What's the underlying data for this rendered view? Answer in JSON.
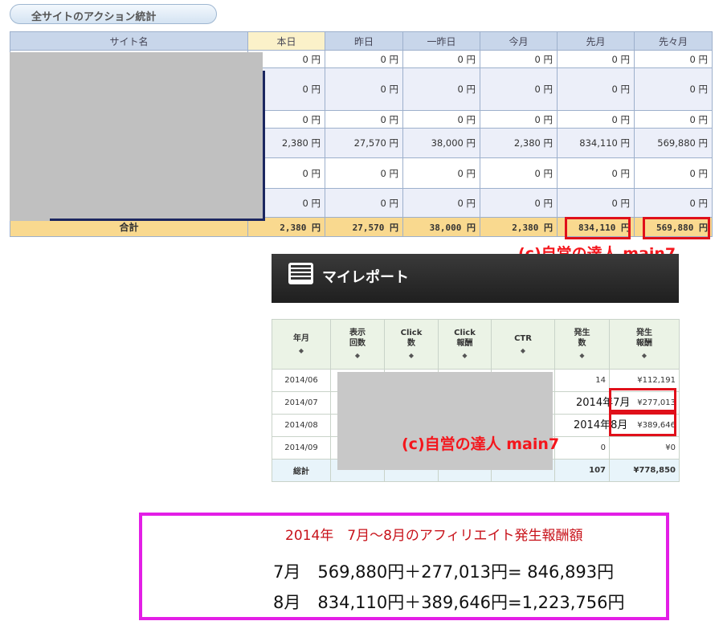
{
  "stats": {
    "title": "全サイトのアクション統計",
    "headers": [
      "サイト名",
      "本日",
      "昨日",
      "一昨日",
      "今月",
      "先月",
      "先々月"
    ],
    "rows": [
      [
        "0 円",
        "0 円",
        "0 円",
        "0 円",
        "0 円",
        "0 円"
      ],
      [
        "0 円",
        "0 円",
        "0 円",
        "0 円",
        "0 円",
        "0 円"
      ],
      [
        "0 円",
        "0 円",
        "0 円",
        "0 円",
        "0 円",
        "0 円"
      ],
      [
        "2,380 円",
        "27,570 円",
        "38,000 円",
        "2,380 円",
        "834,110 円",
        "569,880 円"
      ],
      [
        "0 円",
        "0 円",
        "0 円",
        "0 円",
        "0 円",
        "0 円"
      ],
      [
        "0 円",
        "0 円",
        "0 円",
        "0 円",
        "0 円",
        "0 円"
      ]
    ],
    "total_label": "合計",
    "totals": [
      "2,380 円",
      "27,570 円",
      "38,000 円",
      "2,380 円",
      "834,110 円",
      "569,880 円"
    ]
  },
  "watermark": "(c)自営の達人 main7",
  "my_report": {
    "title": "マイレポート",
    "headers": [
      "年月",
      "表示\n回数",
      "Click\n数",
      "Click\n報酬",
      "CTR",
      "発生\n数",
      "発生\n報酬"
    ],
    "sort_glyph": "◆",
    "rows": [
      {
        "ym": "2014/06",
        "count": "14",
        "reward": "¥112,191"
      },
      {
        "ym": "2014/07",
        "count": "",
        "reward": "¥277,013"
      },
      {
        "ym": "2014/08",
        "count": "",
        "reward": "¥389,646"
      },
      {
        "ym": "2014/09",
        "count": "0",
        "reward": "¥0"
      }
    ],
    "total_label": "総計",
    "total_count": "107",
    "total_reward": "¥778,850",
    "overlay_jul": "2014年7月",
    "overlay_aug": "2014年8月"
  },
  "summary": {
    "heading": "2014年　7月～8月のアフィリエイト発生報酬額",
    "line1": "7月　569,880円＋277,013円=  846,893円",
    "line2": "8月　834,110円＋389,646円=1,223,756円"
  },
  "colors": {
    "highlight_red": "#e0101a",
    "summary_border": "#e31ee6",
    "table_header": "#c8d6ea",
    "total_row": "#f9d98f"
  }
}
